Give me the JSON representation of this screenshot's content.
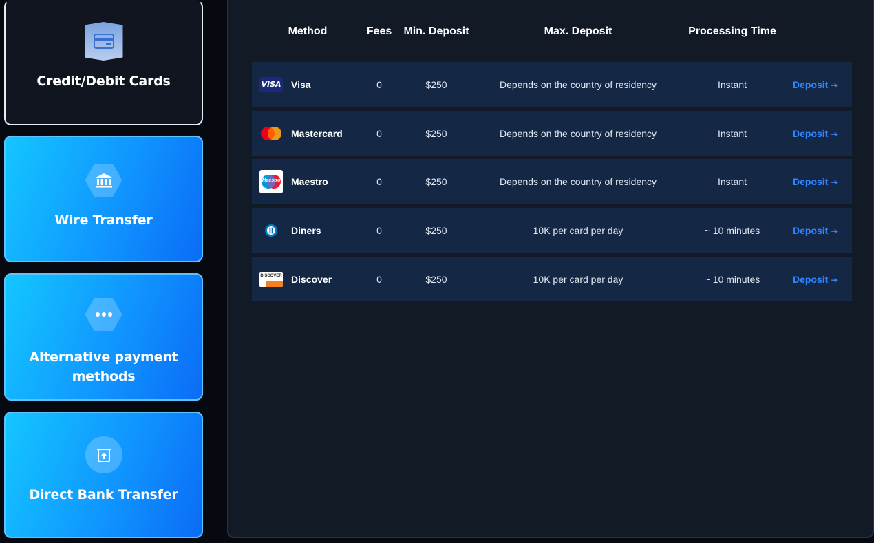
{
  "tabs": [
    {
      "label": "Credit/Debit Cards",
      "icon": "credit-card-icon",
      "active": true
    },
    {
      "label": "Wire Transfer",
      "icon": "bank-icon",
      "active": false
    },
    {
      "label": "Alternative payment methods",
      "icon": "more-icon",
      "active": false
    },
    {
      "label": "Direct Bank Transfer",
      "icon": "bank-transfer-icon",
      "active": false
    }
  ],
  "table": {
    "headers": {
      "method": "Method",
      "fees": "Fees",
      "min_deposit": "Min. Deposit",
      "max_deposit": "Max. Deposit",
      "processing_time": "Processing Time"
    },
    "rows": [
      {
        "method": "Visa",
        "logo": "visa-logo",
        "fees": "0",
        "min_deposit": "$250",
        "max_deposit": "Depends on the country of residency",
        "processing_time": "Instant",
        "action": "Deposit"
      },
      {
        "method": "Mastercard",
        "logo": "mastercard-logo",
        "fees": "0",
        "min_deposit": "$250",
        "max_deposit": "Depends on the country of residency",
        "processing_time": "Instant",
        "action": "Deposit"
      },
      {
        "method": "Maestro",
        "logo": "maestro-logo",
        "fees": "0",
        "min_deposit": "$250",
        "max_deposit": "Depends on the country of residency",
        "processing_time": "Instant",
        "action": "Deposit"
      },
      {
        "method": "Diners",
        "logo": "diners-logo",
        "fees": "0",
        "min_deposit": "$250",
        "max_deposit": "10K per card per day",
        "processing_time": "~ 10 minutes",
        "action": "Deposit"
      },
      {
        "method": "Discover",
        "logo": "discover-logo",
        "fees": "0",
        "min_deposit": "$250",
        "max_deposit": "10K per card per day",
        "processing_time": "~ 10 minutes",
        "action": "Deposit"
      }
    ]
  },
  "logo_text": {
    "visa": "VISA",
    "maestro": "Maestro",
    "discover": "DISCOVER"
  },
  "colors": {
    "accent_link": "#2f86ff",
    "row_bg": "#142744",
    "panel_bg": "#121a26",
    "tab_gradient_start": "#14c6ff",
    "tab_gradient_end": "#0b6cf6"
  }
}
